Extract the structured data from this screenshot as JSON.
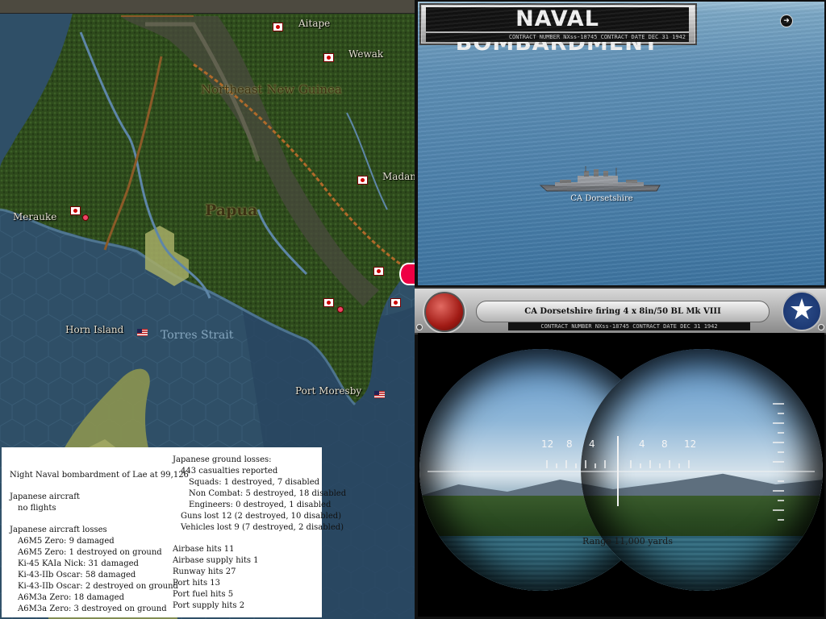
{
  "map": {
    "places": [
      {
        "id": "aitape",
        "label": "Aitape"
      },
      {
        "id": "wewak",
        "label": "Wewak"
      },
      {
        "id": "madang",
        "label": "Madan"
      },
      {
        "id": "merauke",
        "label": "Merauke"
      },
      {
        "id": "horn_island",
        "label": "Horn Island"
      },
      {
        "id": "port_moresby",
        "label": "Port Moresby"
      }
    ],
    "regions": {
      "northeast_new_guinea": "Northeast New Guinea",
      "papua": "Papua"
    },
    "seas": {
      "torres_strait": "Torres Strait"
    }
  },
  "combat_report": {
    "header": "Night Naval bombardment of Lae at 99,126",
    "japanese_aircraft": {
      "label": "Japanese aircraft",
      "detail": "no flights"
    },
    "aircraft_losses": {
      "label": "Japanese aircraft losses",
      "items": [
        "A6M5 Zero: 9 damaged",
        "A6M5 Zero: 1 destroyed on ground",
        "Ki-45 KAIa Nick: 31 damaged",
        "Ki-43-IIb Oscar: 58 damaged",
        "Ki-43-IIb Oscar: 2 destroyed on ground",
        "A6M3a Zero: 18 damaged",
        "A6M3a Zero: 3 destroyed on ground"
      ]
    },
    "ground_losses": {
      "label": "Japanese ground losses:",
      "casualties": "443 casualties reported",
      "units": [
        "Squads: 1 destroyed, 7 disabled",
        "Non Combat: 5 destroyed, 18 disabled",
        "Engineers: 0 destroyed, 1 disabled"
      ],
      "guns": "Guns lost 12 (2 destroyed, 10 disabled)",
      "vehicles": "Vehicles lost 9 (7 destroyed, 2 disabled)"
    },
    "hits": [
      "Airbase hits 11",
      "Airbase supply hits 1",
      "Runway hits 27",
      "Port hits 13",
      "Port fuel hits 5",
      "Port supply hits 2"
    ]
  },
  "bombardment": {
    "title": "NAVAL BOMBARDMENT",
    "plaque_subtitle": "CONTRACT NUMBER  NXss-18745        CONTRACT DATE DEC 31 1942",
    "ship_name": "CA Dorsetshire",
    "status": "CA Dorsetshire firing 4 x 8in/50 BL Mk VIII",
    "contract_strip": "CONTRACT NUMBER  NXss-18745        CONTRACT DATE DEC 31 1942",
    "reticle_ticks": [
      "12",
      "8",
      "4",
      "4",
      "8",
      "12"
    ],
    "range": "Range 11,000 yards",
    "star_icon": "★",
    "nav_icon": "➜"
  },
  "colors": {
    "jungle": "#2f4a1c",
    "sea": "#2f4f67",
    "ocean_deep": "#2a4660",
    "japan_red": "#cc0000"
  }
}
